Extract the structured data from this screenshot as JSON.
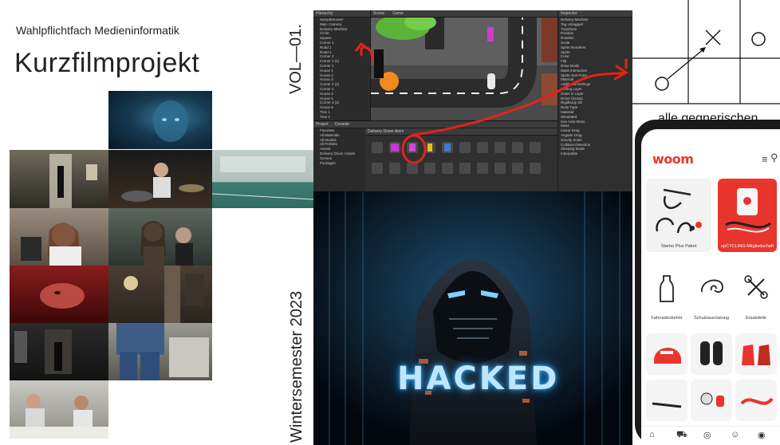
{
  "poster": {
    "subtitle": "Wahlpflichtfach Medieninformatik",
    "title": "Kurzfilmprojekt",
    "volume": "VOL—01.",
    "semester": "Wintersemester 2023"
  },
  "unity": {
    "hierarchy_tab": "Hierarchy",
    "scene_tab": "Scene",
    "game_tab": "Game",
    "inspector_tab": "Inspector",
    "project_tab": "Project",
    "console_tab": "Console",
    "animation_tab": "Delivery Driver Anim",
    "hierarchy_items": [
      "SampleScene*",
      "Main Camera",
      "Delivery Machine",
      "Circle",
      "Square",
      "Corner 1",
      "Road 1",
      "Road 2",
      "Corner 2",
      "Corner 3 (1)",
      "Corner 1",
      "House 1",
      "House 2",
      "House 3",
      "Corner 2 (1)",
      "Corner 4",
      "House 4",
      "House 5",
      "Corner 3 (1)",
      "House 6",
      "Tree 1",
      "Tree 2",
      "Tree 3 (1)",
      "Tree 4"
    ],
    "inspector_rows": [
      "Delivery Machine",
      "Tag Untagged",
      "Transform",
      "Position",
      "Rotation",
      "Scale",
      "Sprite Renderer",
      "Sprite",
      "Color",
      "Flip",
      "Draw Mode",
      "Mask Interaction",
      "Sprite Sort Point",
      "Material",
      "Additional Settings",
      "Sorting Layer",
      "Order in Layer",
      "Driver (Script)",
      "Rigidbody 2D",
      "Body Type",
      "Material",
      "Simulated",
      "Use Auto Mass",
      "Mass",
      "Linear Drag",
      "Angular Drag",
      "Gravity Scale",
      "Collision Detection",
      "Sleeping Mode",
      "Interpolate"
    ],
    "project_items": [
      "Favorites",
      "All Materials",
      "All Models",
      "All Prefabs",
      "Assets",
      "Delivery Driver Assets",
      "Scenes",
      "Packages"
    ]
  },
  "hacker": {
    "overlay_text": "HACKED"
  },
  "ttt": {
    "caption": "alle gegnerischen"
  },
  "phone": {
    "brand": "woom",
    "menu_icon": "menu-icon",
    "search_icon": "search-icon",
    "cards": [
      {
        "label": "Starter Plus Paket"
      },
      {
        "label": "upCYCLING-Mitgliedschaft"
      },
      {
        "label": "Fahrradzubehör"
      },
      {
        "label": "Schutzausrüstung"
      },
      {
        "label": "Ersatzteile"
      }
    ],
    "nav": [
      "home-icon",
      "cart-icon",
      "location-icon",
      "support-icon",
      "account-icon"
    ]
  },
  "colors": {
    "woom_red": "#e8352e",
    "annotation_red": "#e0241b",
    "unity_dark": "#383838",
    "hacked_glow": "#38b8ff"
  }
}
